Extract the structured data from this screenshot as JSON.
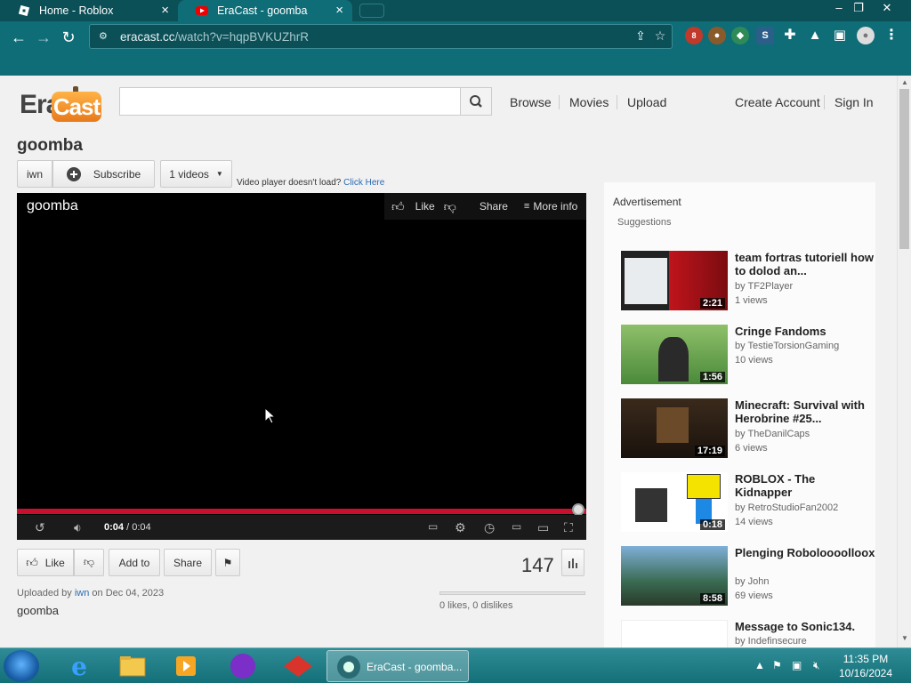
{
  "browser": {
    "tabs": [
      {
        "title": "Home - Roblox",
        "active": false
      },
      {
        "title": "EraCast - goomba",
        "active": true
      }
    ],
    "url_host": "eracast.cc",
    "url_path": "/watch?v=hqpBVKUZhrR",
    "extension_badge": "8"
  },
  "site": {
    "logo_era": "Era",
    "logo_cast": "Cast",
    "nav": {
      "browse": "Browse",
      "movies": "Movies",
      "upload": "Upload",
      "create_account": "Create Account",
      "sign_in": "Sign In"
    }
  },
  "video": {
    "title": "goomba",
    "channel": "iwn",
    "subscribe": "Subscribe",
    "videos_count": "1 videos",
    "load_hint": "Video player doesn't load?",
    "click_here": "Click Here",
    "player_title": "goomba",
    "player_actions": {
      "like": "Like",
      "share": "Share",
      "more_info": "More info"
    },
    "time_current": "0:04",
    "time_total": "/ 0:04",
    "progress": 1.0,
    "buttons": {
      "like": "Like",
      "add_to": "Add to",
      "share": "Share"
    },
    "views": "147",
    "uploaded_by_prefix": "Uploaded by",
    "uploader": "iwn",
    "upload_date": "on Dec 04, 2023",
    "description": "goomba",
    "rating_text": "0 likes, 0 dislikes"
  },
  "sidebar": {
    "advertisement": "Advertisement",
    "suggestions_label": "Suggestions",
    "items": [
      {
        "title": "team fortras tutoriell how to dolod an...",
        "by": "by TF2Player",
        "views": "1 views",
        "duration": "2:21"
      },
      {
        "title": "Cringe Fandoms",
        "by": "by TestieTorsionGaming",
        "views": "10 views",
        "duration": "1:56"
      },
      {
        "title": "Minecraft: Survival with Herobrine #25...",
        "by": "by TheDanilCaps",
        "views": "6 views",
        "duration": "17:19"
      },
      {
        "title": "ROBLOX - The Kidnapper",
        "by": "by RetroStudioFan2002",
        "views": "14 views",
        "duration": "0:18"
      },
      {
        "title": "Plenging Roboloooolloox",
        "by": "by John",
        "views": "69 views",
        "duration": "8:58"
      },
      {
        "title": "Message to Sonic134.",
        "by": "by Indefinsecure",
        "views": "",
        "duration": ""
      }
    ]
  },
  "taskbar": {
    "active_window": "EraCast - goomba...",
    "time": "11:35 PM",
    "date": "10/16/2024"
  }
}
